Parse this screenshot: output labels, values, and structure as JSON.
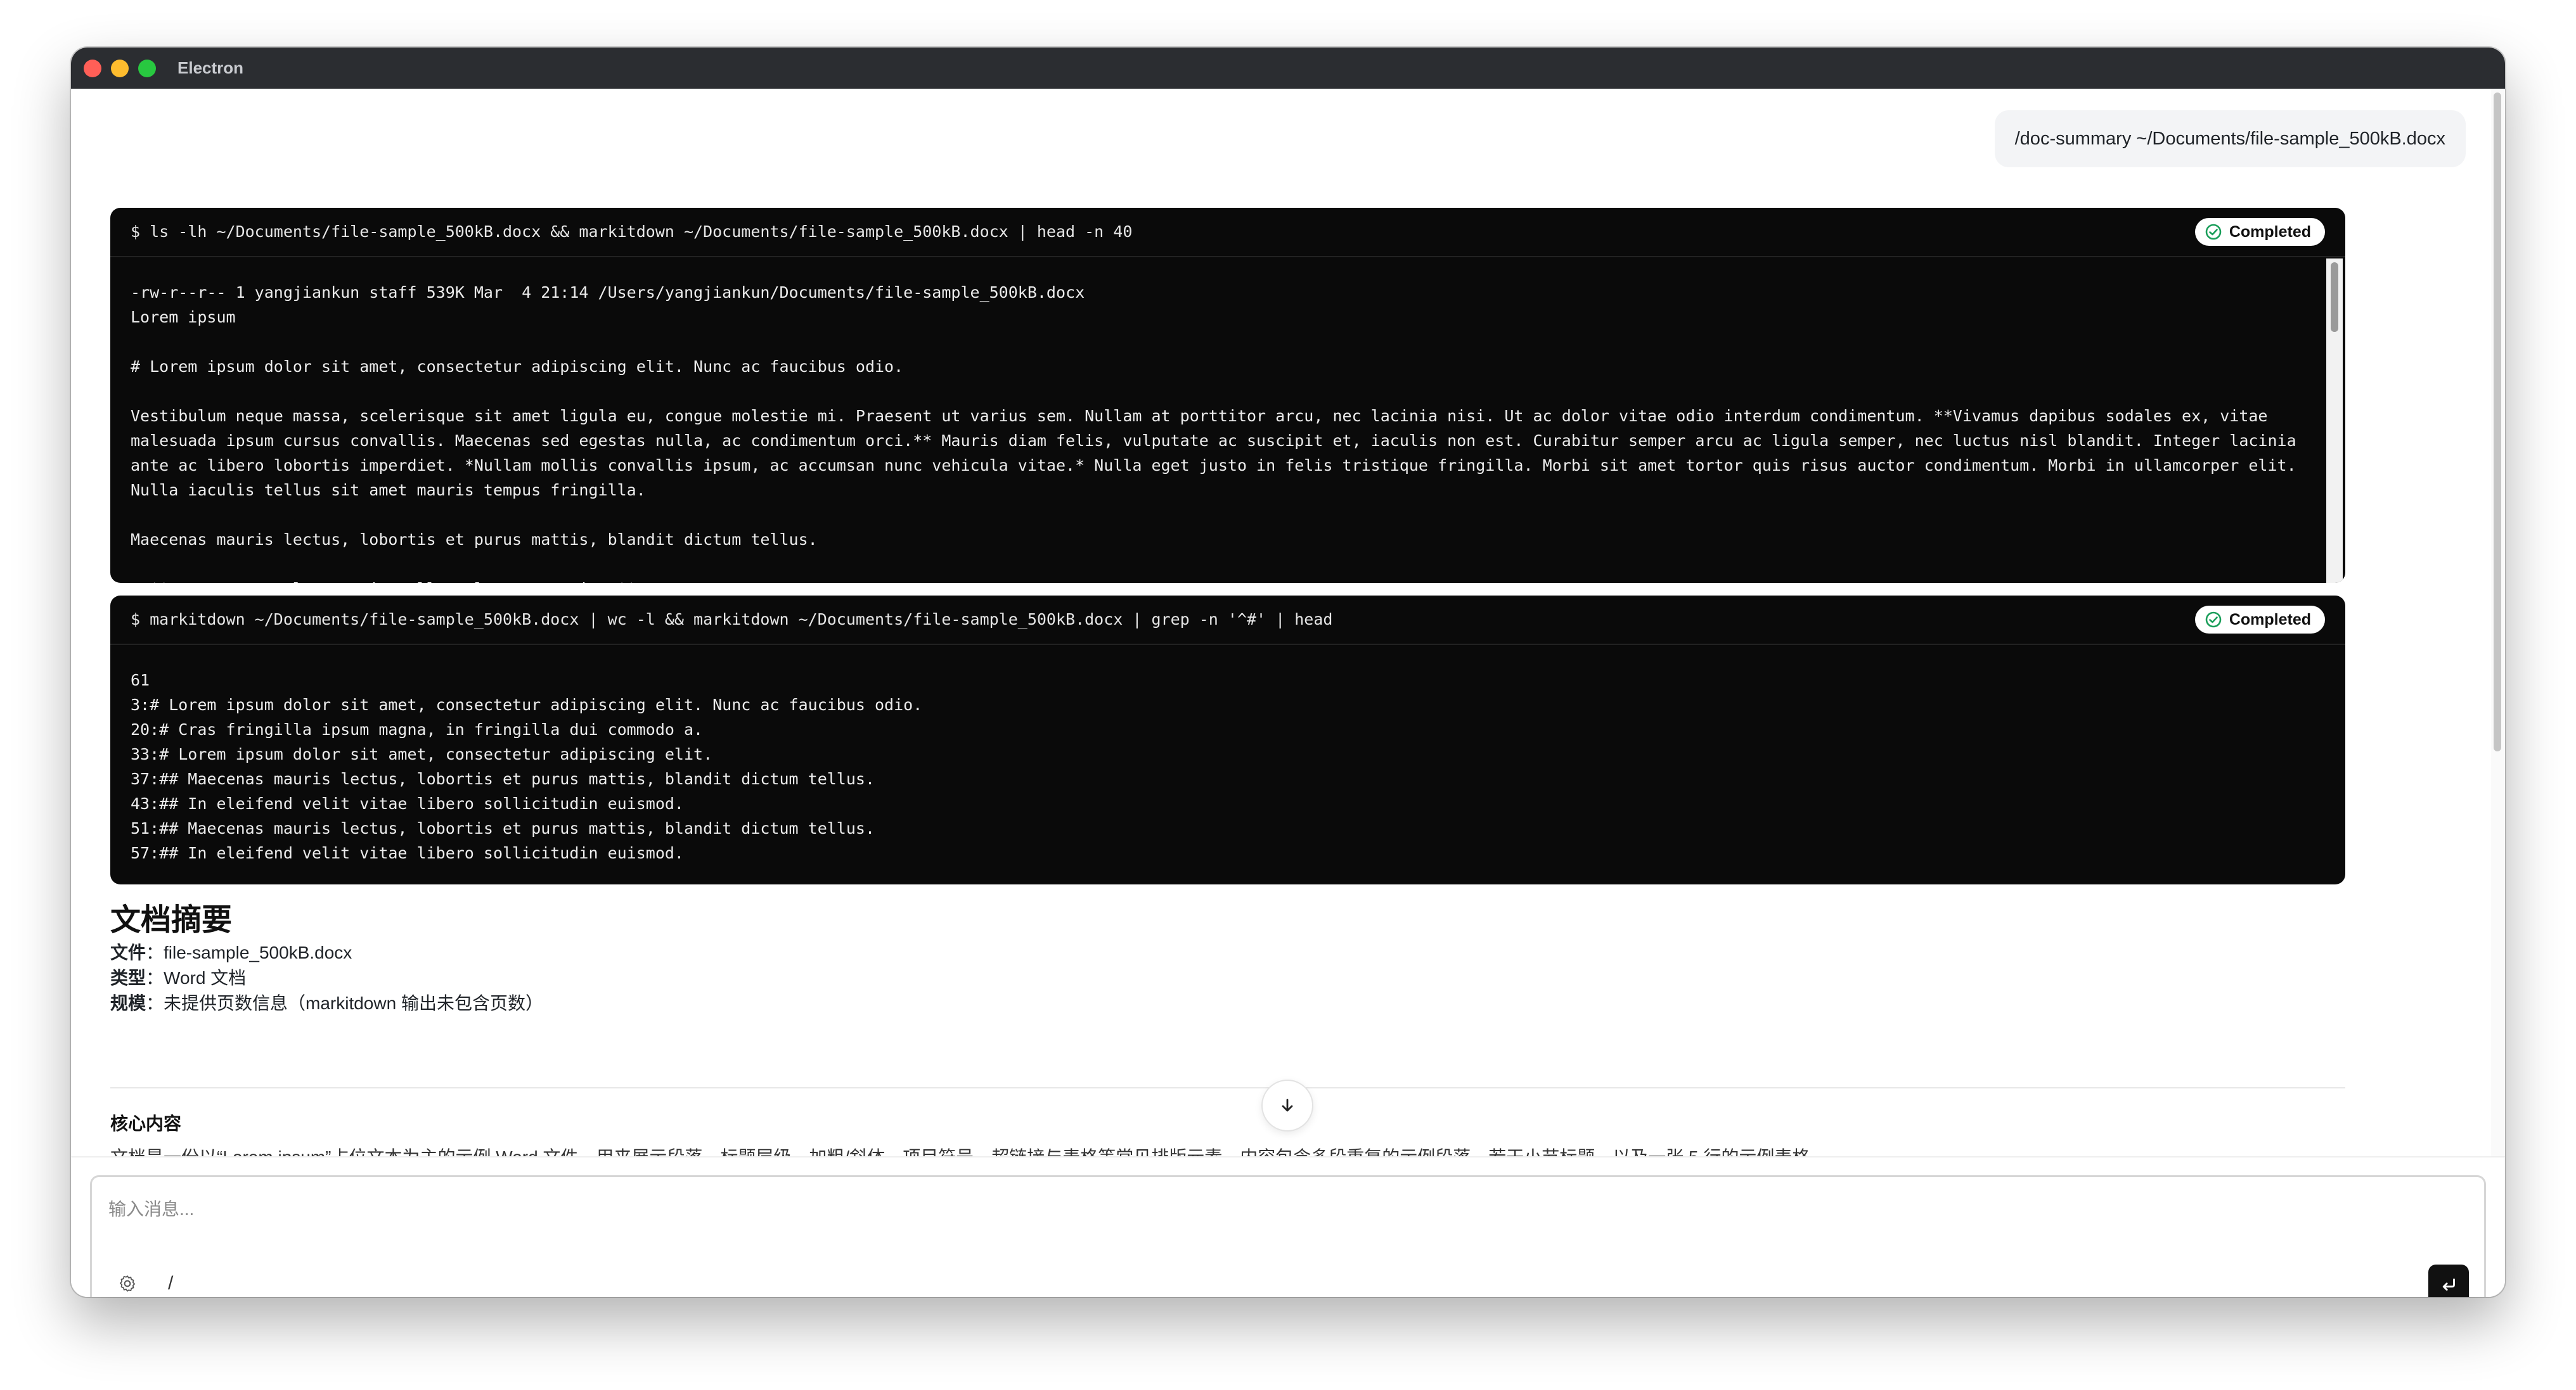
{
  "window": {
    "title": "Electron"
  },
  "user_message": "/doc-summary ~/Documents/file-sample_500kB.docx",
  "terminals": [
    {
      "command": "$ ls -lh ~/Documents/file-sample_500kB.docx && markitdown ~/Documents/file-sample_500kB.docx | head -n 40",
      "status": "Completed",
      "output": "-rw-r--r-- 1 yangjiankun staff 539K Mar  4 21:14 /Users/yangjiankun/Documents/file-sample_500kB.docx\nLorem ipsum\n\n# Lorem ipsum dolor sit amet, consectetur adipiscing elit. Nunc ac faucibus odio.\n\nVestibulum neque massa, scelerisque sit amet ligula eu, congue molestie mi. Praesent ut varius sem. Nullam at porttitor arcu, nec lacinia nisi. Ut ac dolor vitae odio interdum condimentum. **Vivamus dapibus sodales ex, vitae malesuada ipsum cursus convallis. Maecenas sed egestas nulla, ac condimentum orci.** Mauris diam felis, vulputate ac suscipit et, iaculis non est. Curabitur semper arcu ac ligula semper, nec luctus nisl blandit. Integer lacinia ante ac libero lobortis imperdiet. *Nullam mollis convallis ipsum, ac accumsan nunc vehicula vitae.* Nulla eget justo in felis tristique fringilla. Morbi sit amet tortor quis risus auctor condimentum. Morbi in ullamcorper elit. Nulla iaculis tellus sit amet mauris tempus fringilla.\n\nMaecenas mauris lectus, lobortis et purus mattis, blandit dictum tellus.\n\n- **Maecenas non lorem quis tellus placerat varius.**"
    },
    {
      "command": "$ markitdown ~/Documents/file-sample_500kB.docx | wc -l && markitdown ~/Documents/file-sample_500kB.docx | grep -n '^#' | head",
      "status": "Completed",
      "output": "61\n3:# Lorem ipsum dolor sit amet, consectetur adipiscing elit. Nunc ac faucibus odio.\n20:# Cras fringilla ipsum magna, in fringilla dui commodo a.\n33:# Lorem ipsum dolor sit amet, consectetur adipiscing elit.\n37:## Maecenas mauris lectus, lobortis et purus mattis, blandit dictum tellus.\n43:## In eleifend velit vitae libero sollicitudin euismod.\n51:## Maecenas mauris lectus, lobortis et purus mattis, blandit dictum tellus.\n57:## In eleifend velit vitae libero sollicitudin euismod."
    }
  ],
  "summary": {
    "title": "文档摘要",
    "file_label": "文件",
    "file_value": "：file-sample_500kB.docx",
    "type_label": "类型",
    "type_value": "：Word 文档",
    "scale_label": "规模",
    "scale_value": "：未提供页数信息（markitdown 输出未包含页数）",
    "section_title": "核心内容",
    "section_text": "文档是一份以“Lorem ipsum”占位文本为主的示例 Word 文件，用来展示段落、标题层级、加粗/斜体、项目符号、超链接与表格等常见排版元素。内容包含多段重复的示例段落、若干小节标题，以及一张 5 行的示例表格。"
  },
  "input": {
    "placeholder": "输入消息...",
    "slash_label": "/"
  },
  "icons": {
    "status": "check-circle-icon",
    "scroll_down": "arrow-down-icon",
    "settings": "gear-icon",
    "send": "enter-icon"
  },
  "colors": {
    "titlebar": "#2b2d31",
    "terminal_bg": "#0a0a0a",
    "status_green": "#1a9e5a"
  }
}
